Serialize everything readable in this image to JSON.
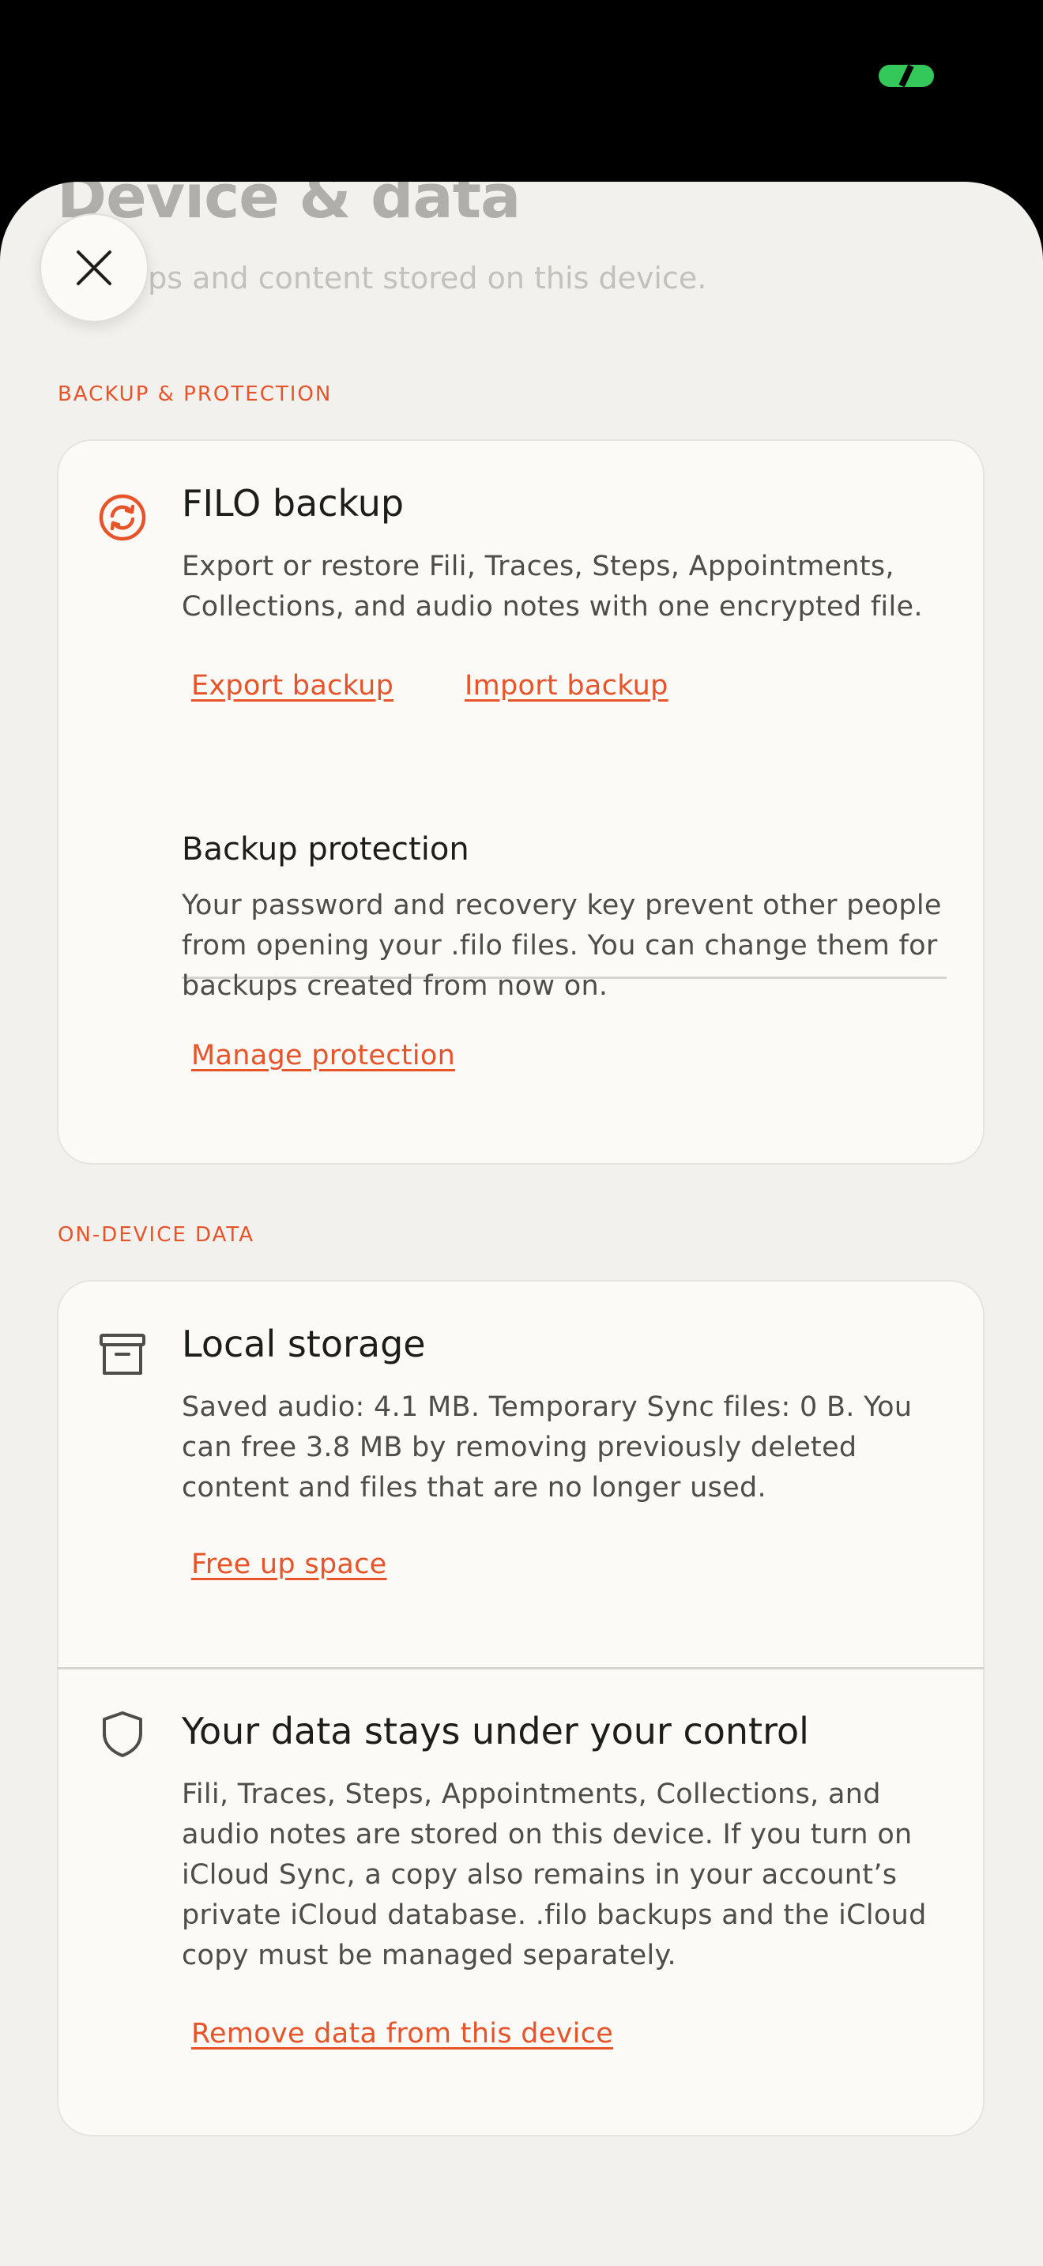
{
  "header": {
    "title": "Device & data",
    "subtitle": "Backups and content stored on this device."
  },
  "close_icon": "close-icon",
  "colors": {
    "accent": "#e8542a",
    "sheet_background": "#f2f1ed",
    "card_background": "#fbfaf6",
    "status_indicator": "#34c759"
  },
  "sections": {
    "backup": {
      "label": "BACKUP & PROTECTION",
      "filo_backup": {
        "icon": "sync-icon",
        "title": "FILO backup",
        "description": "Export or restore Fili, Traces, Steps, Appointments, Collections, and audio notes with one encrypted file.",
        "export_label": "Export backup",
        "import_label": "Import backup"
      },
      "protection": {
        "title": "Backup protection",
        "description": "Your password and recovery key prevent other people from opening your .filo files. You can change them for backups created from now on.",
        "manage_label": "Manage protection"
      }
    },
    "on_device": {
      "label": "ON-DEVICE DATA",
      "local_storage": {
        "icon": "archive-box-icon",
        "title": "Local storage",
        "description": "Saved audio: 4.1 MB. Temporary Sync files: 0 B. You can free 3.8 MB by removing previously deleted content and files that are no longer used.",
        "free_up_label": "Free up space"
      },
      "control": {
        "icon": "shield-icon",
        "title": "Your data stays under your control",
        "description": "Fili, Traces, Steps, Appointments, Collections, and audio notes are stored on this device. If you turn on iCloud Sync, a copy also remains in your account’s private iCloud database. .filo backups and the iCloud copy must be managed separately.",
        "remove_label": "Remove data from this device"
      }
    }
  }
}
